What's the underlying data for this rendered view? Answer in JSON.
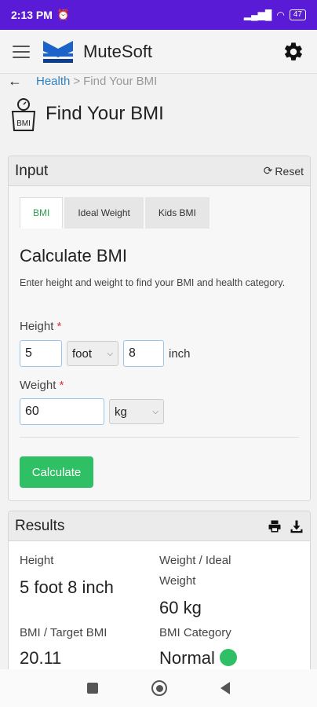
{
  "status_bar": {
    "time": "2:13 PM",
    "battery": "47"
  },
  "app_bar": {
    "brand": "MuteSoft"
  },
  "breadcrumb": {
    "parent": "Health",
    "separator": ">",
    "current": "Find Your BMI"
  },
  "page": {
    "title": "Find Your BMI",
    "icon_label": "BMI"
  },
  "input_card": {
    "title": "Input",
    "reset_label": "Reset",
    "tabs": [
      {
        "label": "BMI",
        "active": true
      },
      {
        "label": "Ideal Weight",
        "active": false
      },
      {
        "label": "Kids BMI",
        "active": false
      }
    ],
    "calc_title": "Calculate BMI",
    "description": "Enter height and weight to find your BMI and health category.",
    "height": {
      "label": "Height",
      "required_mark": "*",
      "feet_value": "5",
      "feet_unit": "foot",
      "inch_value": "8",
      "inch_unit": "inch"
    },
    "weight": {
      "label": "Weight",
      "required_mark": "*",
      "value": "60",
      "unit": "kg"
    },
    "calculate_label": "Calculate"
  },
  "results_card": {
    "title": "Results",
    "height_label": "Height",
    "height_value": "5 foot 8 inch",
    "weight_label_line1": "Weight / Ideal",
    "weight_label_line2": "Weight",
    "weight_value": "60 kg",
    "bmi_label": "BMI / Target BMI",
    "bmi_value": "20.11",
    "category_label": "BMI Category",
    "category_value": "Normal"
  },
  "colors": {
    "status_bar": "#5a1bd6",
    "accent_green": "#2fbf64",
    "link_blue": "#2f7fbf"
  }
}
